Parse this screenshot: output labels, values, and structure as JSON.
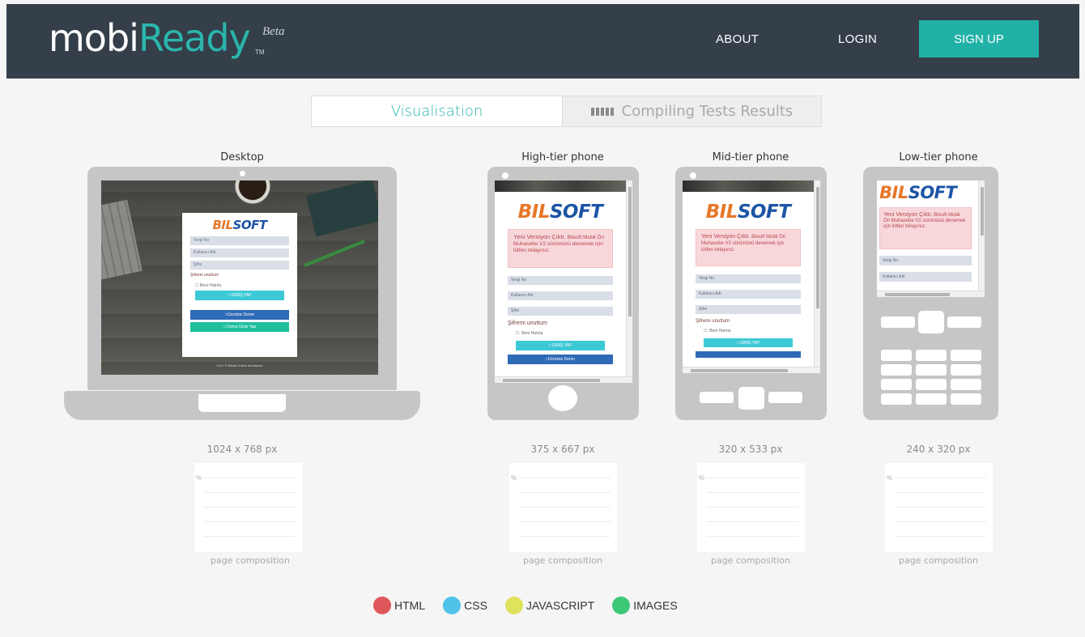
{
  "header": {
    "logo_part1": "mobi",
    "logo_part2": "Ready",
    "logo_tm": "TM",
    "logo_beta": "Beta",
    "nav_about": "ABOUT",
    "nav_login": "LOGIN",
    "signup_label": "SIGN UP"
  },
  "tabs": {
    "visualisation": "Visualisation",
    "compiling": "Compiling Tests Results"
  },
  "devices": [
    {
      "title": "Desktop",
      "resolution": "1024 x 768 px",
      "composition_label": "page composition",
      "pct": "%"
    },
    {
      "title": "High-tier phone",
      "resolution": "375 x 667 px",
      "composition_label": "page composition",
      "pct": "%"
    },
    {
      "title": "Mid-tier phone",
      "resolution": "320 x 533 px",
      "composition_label": "page composition",
      "pct": "%"
    },
    {
      "title": "Low-tier phone",
      "resolution": "240 x 320 px",
      "composition_label": "page composition",
      "pct": "%"
    }
  ],
  "preview": {
    "brand_bil": "BIL",
    "brand_soft": "SOFT",
    "field_vergi": "Vergi No",
    "field_kullanici": "Kullanıcı Adı",
    "field_sifre": "Şifre",
    "forgot": "Şifremi unuttum",
    "remember": "Beni Hatırla",
    "login_btn": "□ GİRİŞ YAP",
    "free_demo_btn": "□Ücretsiz Deme",
    "demo_login_btn": "□ Demo Girişi Yap",
    "footer": "2021 © Bilsoft Online Muhasebe",
    "alert_title": "Yeni Versiyon Çıktı.",
    "alert_body": "Bilsoft Mobil Ön Muhasebe V2 sürümünü denemek için lütfen",
    "alert_link": "tıklayınız.",
    "phone_free_demo_btn": "□Ücretsiz Demo"
  },
  "legend": [
    {
      "label": "HTML",
      "color": "#e0575b"
    },
    {
      "label": "CSS",
      "color": "#4fc3e8"
    },
    {
      "label": "JAVASCRIPT",
      "color": "#dfe25b"
    },
    {
      "label": "IMAGES",
      "color": "#3dc877"
    }
  ]
}
